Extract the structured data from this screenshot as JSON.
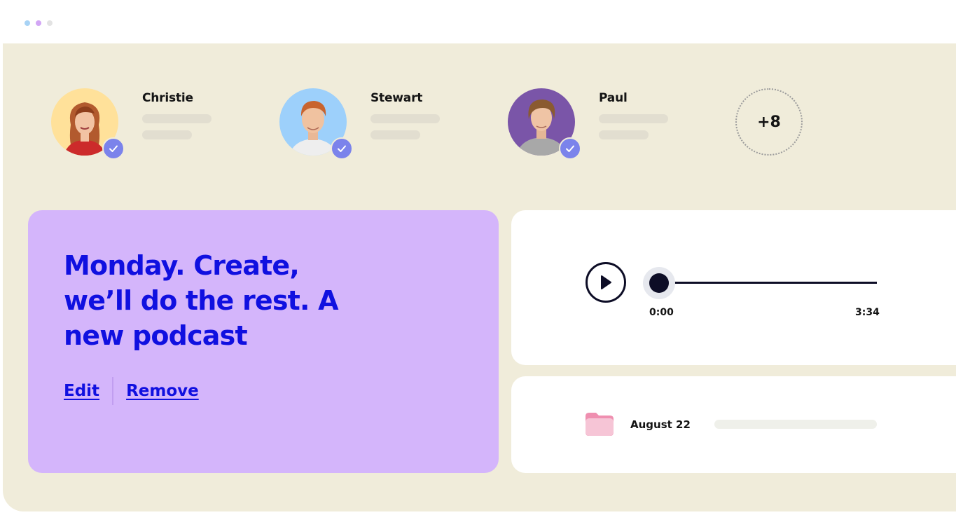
{
  "window": {
    "dot_colors": [
      "#a8d3f5",
      "#d2a6f5",
      "#e3e3e3"
    ]
  },
  "team": {
    "members": [
      {
        "name": "Christie",
        "avatar_bg": "#ffe19a",
        "verified": true
      },
      {
        "name": "Stewart",
        "avatar_bg": "#9dd0fb",
        "verified": true
      },
      {
        "name": "Paul",
        "avatar_bg": "#7a55a8",
        "verified": true
      }
    ],
    "more_count": "+8"
  },
  "podcast": {
    "title": "Monday. Create, we’ll do the rest. A new podcast",
    "edit_label": "Edit",
    "remove_label": "Remove"
  },
  "player": {
    "current_time": "0:00",
    "total_time": "3:34",
    "progress": 0,
    "play_icon": "play-icon"
  },
  "file": {
    "date": "August 22",
    "icon": "folder-icon"
  },
  "colors": {
    "background": "#f0ecda",
    "podcast_card": "#d4b5fb",
    "accent_text": "#1010e0",
    "check_badge": "#7b83eb",
    "dark": "#0d0d26"
  }
}
